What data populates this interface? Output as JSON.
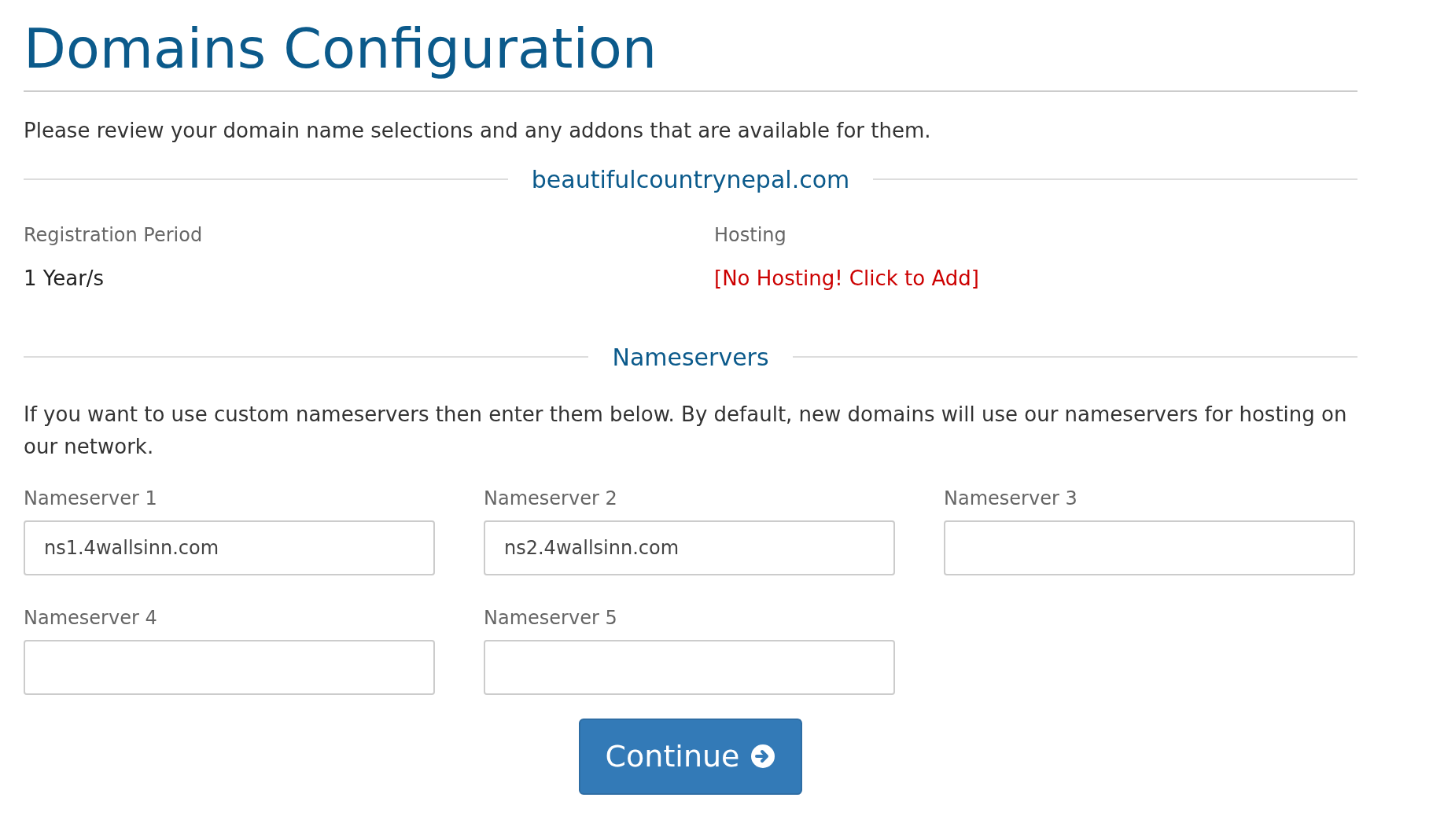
{
  "title": "Domains Configuration",
  "intro": "Please review your domain name selections and any addons that are available for them.",
  "domain": "beautifulcountrynepal.com",
  "registration": {
    "label": "Registration Period",
    "value": "1 Year/s"
  },
  "hosting": {
    "label": "Hosting",
    "link": "[No Hosting! Click to Add]"
  },
  "nameservers_heading": "Nameservers",
  "nameservers_text": "If you want to use custom nameservers then enter them below. By default, new domains will use our nameservers for hosting on our network.",
  "nameservers": [
    {
      "label": "Nameserver 1",
      "value": "ns1.4wallsinn.com"
    },
    {
      "label": "Nameserver 2",
      "value": "ns2.4wallsinn.com"
    },
    {
      "label": "Nameserver 3"
    },
    {
      "label": "Nameserver 4"
    },
    {
      "label": "Nameserver 5"
    }
  ],
  "continue_button": "Continue"
}
